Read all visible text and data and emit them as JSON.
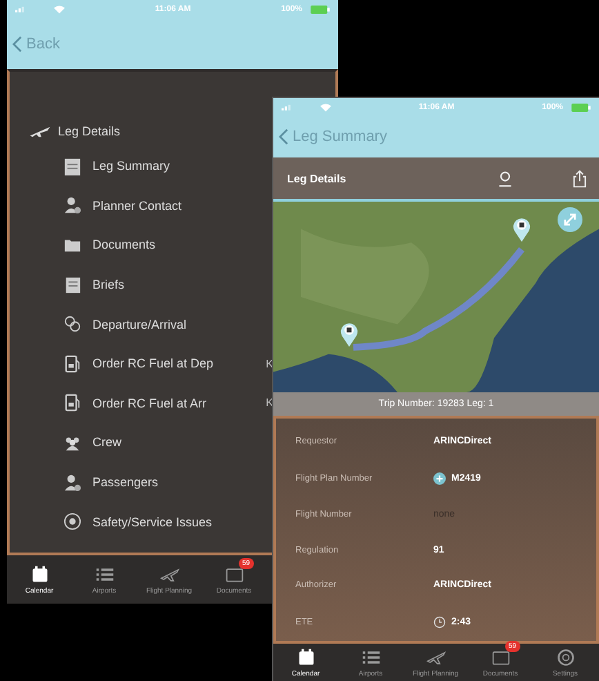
{
  "back_screen": {
    "status_bar": {
      "time": "11:06 AM",
      "battery": "100%"
    },
    "nav": {
      "back": "Back"
    },
    "menu": {
      "header": {
        "label": "Leg Details"
      },
      "items": [
        {
          "label": "Leg Summary",
          "kind": "summary"
        },
        {
          "label": "Planner Contact",
          "kind": "person"
        },
        {
          "label": "Documents",
          "kind": "folder"
        },
        {
          "label": "Briefs",
          "kind": "doc"
        },
        {
          "label": "Departure/Arrival",
          "kind": "depart"
        },
        {
          "label": "Order RC Fuel at Dep",
          "kind": "fuel",
          "trailing": "K"
        },
        {
          "label": "Order RC Fuel at Arr",
          "kind": "fuel",
          "trailing": "K"
        },
        {
          "label": "Crew",
          "kind": "crew"
        },
        {
          "label": "Passengers",
          "kind": "person"
        },
        {
          "label": "Safety/Service Issues",
          "kind": "target"
        }
      ]
    },
    "tab_bar": [
      {
        "label": "Calendar",
        "kind": "calendar",
        "selected": true
      },
      {
        "label": "Airports",
        "kind": "list",
        "selected": false
      },
      {
        "label": "Flight Planning",
        "kind": "plane",
        "selected": false
      },
      {
        "label": "Documents",
        "kind": "docs",
        "selected": false,
        "badge": "59"
      }
    ]
  },
  "front_screen": {
    "status_bar": {
      "time": "11:06 AM",
      "battery": "100%"
    },
    "nav": {
      "back": "Leg Summary"
    },
    "header": {
      "title": "Leg Details"
    },
    "trip_bar": "Trip Number:  19283 Leg: 1",
    "details": [
      {
        "label": "Requestor",
        "value": "ARINCDirect",
        "kind": "text",
        "muted": false
      },
      {
        "label": "Flight Plan Number",
        "value": "M2419",
        "kind": "plan",
        "muted": false
      },
      {
        "label": "Flight Number",
        "value": "none",
        "kind": "text",
        "muted": true
      },
      {
        "label": "Regulation",
        "value": "91",
        "kind": "text",
        "muted": false
      },
      {
        "label": "Authorizer",
        "value": "ARINCDirect",
        "kind": "text",
        "muted": false
      },
      {
        "label": "ETE",
        "value": "2:43",
        "kind": "duration",
        "muted": false
      }
    ],
    "tab_bar": [
      {
        "label": "Calendar",
        "kind": "calendar",
        "selected": true
      },
      {
        "label": "Airports",
        "kind": "list",
        "selected": false
      },
      {
        "label": "Flight Planning",
        "kind": "plane",
        "selected": false
      },
      {
        "label": "Documents",
        "kind": "docs",
        "selected": false,
        "badge": "59"
      },
      {
        "label": "Settings",
        "kind": "gear",
        "selected": false
      }
    ]
  }
}
